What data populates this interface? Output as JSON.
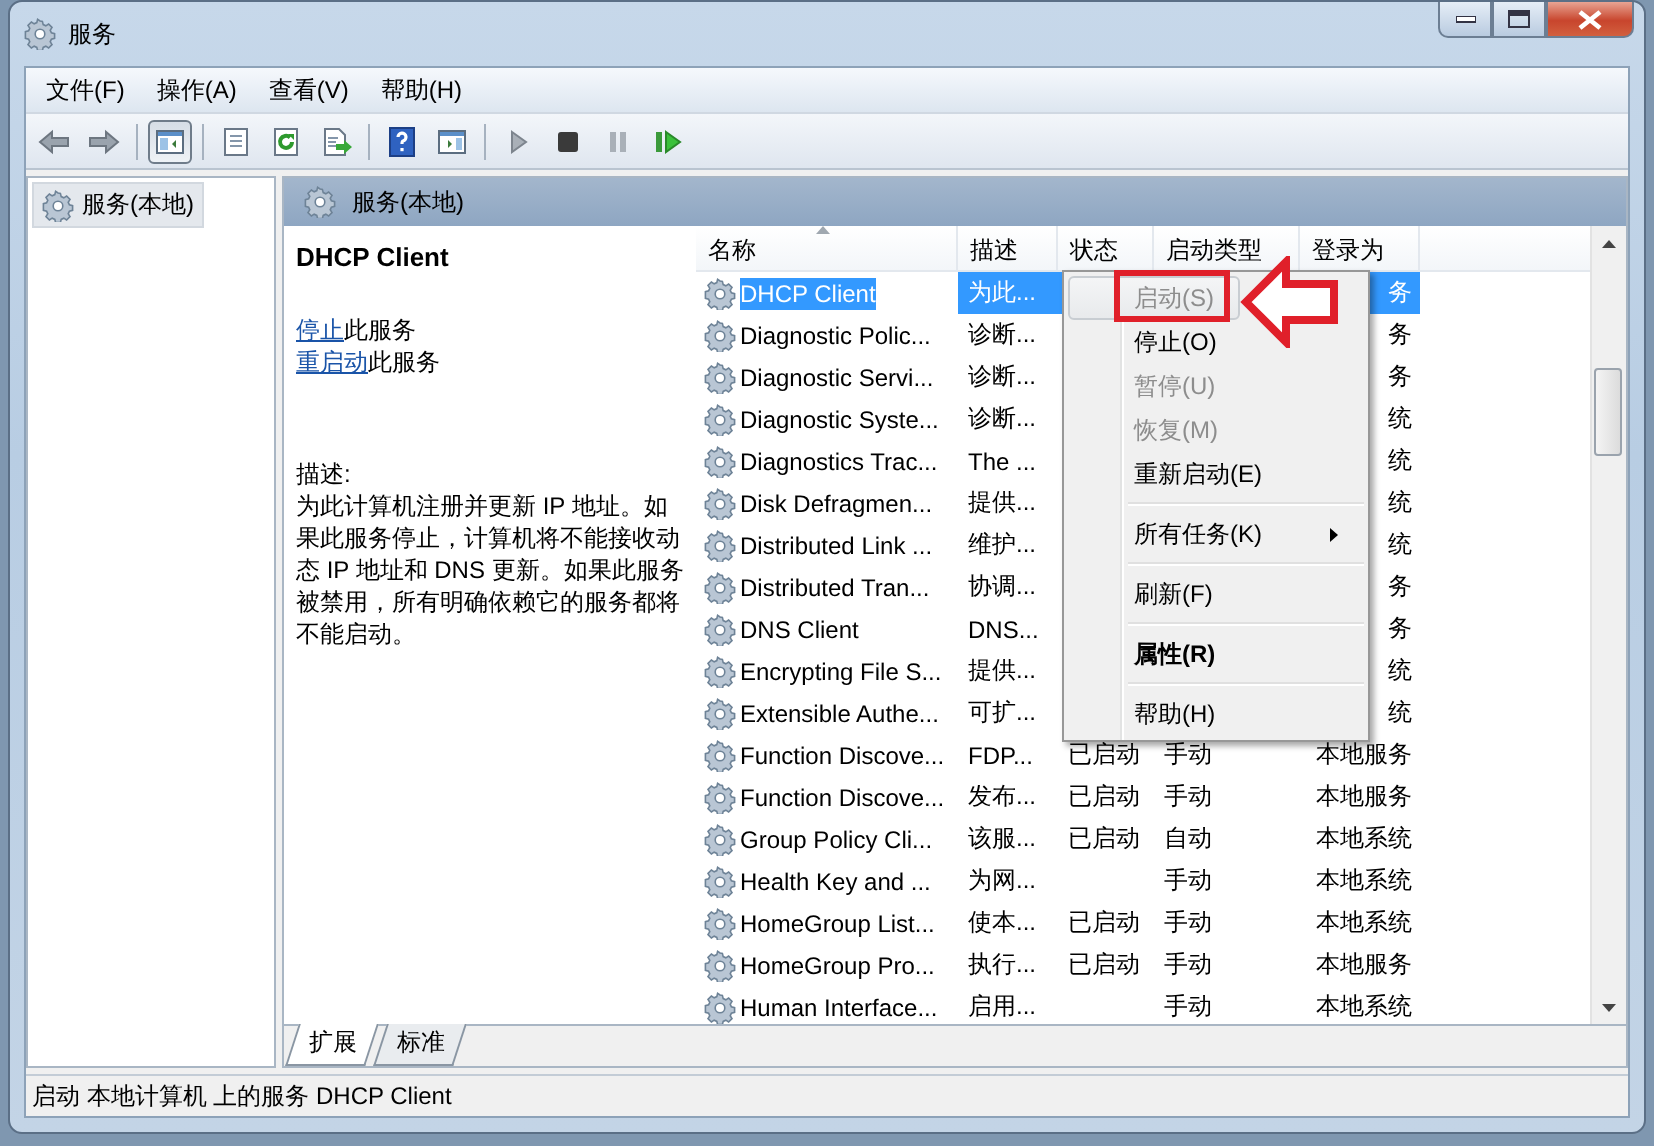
{
  "window": {
    "title": "服务"
  },
  "menubar": [
    "文件(F)",
    "操作(A)",
    "查看(V)",
    "帮助(H)"
  ],
  "toolbar": [
    {
      "kind": "back"
    },
    {
      "kind": "forward"
    },
    {
      "kind": "separator"
    },
    {
      "kind": "tree",
      "pressed": true
    },
    {
      "kind": "separator"
    },
    {
      "kind": "properties"
    },
    {
      "kind": "refresh"
    },
    {
      "kind": "export"
    },
    {
      "kind": "separator"
    },
    {
      "kind": "help"
    },
    {
      "kind": "pane",
      "pressed": false
    },
    {
      "kind": "separator"
    },
    {
      "kind": "play"
    },
    {
      "kind": "stop"
    },
    {
      "kind": "pause"
    },
    {
      "kind": "resume"
    }
  ],
  "tree": {
    "items": [
      {
        "label": "服务(本地)",
        "selected": true
      }
    ]
  },
  "pane_header": "服务(本地)",
  "details": {
    "title": "DHCP Client",
    "actions": [
      {
        "link": "停止",
        "text": "此服务"
      },
      {
        "link": "重启动",
        "text": "此服务"
      }
    ],
    "description_label": "描述:",
    "description": "为此计算机注册并更新 IP 地址。如果此服务停止，计算机将不能接收动态 IP 地址和 DNS 更新。如果此服务被禁用，所有明确依赖它的服务都将不能启动。"
  },
  "table": {
    "columns": [
      "名称",
      "描述",
      "状态",
      "启动类型",
      "登录为"
    ],
    "rows": [
      {
        "name": "DHCP Client",
        "description": "为此...",
        "login_as": "务",
        "selected": true
      },
      {
        "name": "Diagnostic Polic...",
        "description": "诊断...",
        "login_as": "务",
        "selected": false
      },
      {
        "name": "Diagnostic Servi...",
        "description": "诊断...",
        "login_as": "务",
        "selected": false
      },
      {
        "name": "Diagnostic Syste...",
        "description": "诊断...",
        "login_as": "统",
        "selected": false
      },
      {
        "name": "Diagnostics Trac...",
        "description": "The ...",
        "login_as": "统",
        "selected": false
      },
      {
        "name": "Disk Defragmen...",
        "description": "提供...",
        "login_as": "统",
        "selected": false
      },
      {
        "name": "Distributed Link ...",
        "description": "维护...",
        "login_as": "统",
        "selected": false
      },
      {
        "name": "Distributed Tran...",
        "description": "协调...",
        "login_as": "务",
        "selected": false
      },
      {
        "name": "DNS Client",
        "description": "DNS...",
        "login_as": "务",
        "selected": false
      },
      {
        "name": "Encrypting File S...",
        "description": "提供...",
        "login_as": "统",
        "selected": false
      },
      {
        "name": "Extensible Authe...",
        "description": "可扩...",
        "login_as": "统",
        "selected": false
      },
      {
        "name": "Function Discove...",
        "description": "FDP...",
        "status": "已启动",
        "startup_type": "手动",
        "login_as": "本地服务",
        "selected": false
      },
      {
        "name": "Function Discove...",
        "description": "发布...",
        "status": "已启动",
        "startup_type": "手动",
        "login_as": "本地服务",
        "selected": false
      },
      {
        "name": "Group Policy Cli...",
        "description": "该服...",
        "status": "已启动",
        "startup_type": "自动",
        "login_as": "本地系统",
        "selected": false
      },
      {
        "name": "Health Key and ...",
        "description": "为网...",
        "startup_type": "手动",
        "login_as": "本地系统",
        "selected": false
      },
      {
        "name": "HomeGroup List...",
        "description": "使本...",
        "status": "已启动",
        "startup_type": "手动",
        "login_as": "本地系统",
        "selected": false
      },
      {
        "name": "HomeGroup Pro...",
        "description": "执行...",
        "status": "已启动",
        "startup_type": "手动",
        "login_as": "本地服务",
        "selected": false
      },
      {
        "name": "Human Interface...",
        "description": "启用...",
        "startup_type": "手动",
        "login_as": "本地系统",
        "selected": false
      }
    ]
  },
  "context_menu": [
    {
      "kind": "item",
      "label": "启动(S)",
      "disabled": true,
      "selected": true,
      "annotated": true
    },
    {
      "kind": "item",
      "label": "停止(O)",
      "disabled": false,
      "selected": false
    },
    {
      "kind": "item",
      "label": "暂停(U)",
      "disabled": true,
      "selected": false
    },
    {
      "kind": "item",
      "label": "恢复(M)",
      "disabled": true,
      "selected": false
    },
    {
      "kind": "item",
      "label": "重新启动(E)",
      "disabled": false,
      "selected": false
    },
    {
      "kind": "separator"
    },
    {
      "kind": "item",
      "label": "所有任务(K)",
      "disabled": false,
      "selected": false,
      "submenu": true
    },
    {
      "kind": "separator"
    },
    {
      "kind": "item",
      "label": "刷新(F)",
      "disabled": false,
      "selected": false
    },
    {
      "kind": "separator"
    },
    {
      "kind": "item",
      "label": "属性(R)",
      "disabled": false,
      "selected": false,
      "bold": true
    },
    {
      "kind": "separator"
    },
    {
      "kind": "item",
      "label": "帮助(H)",
      "disabled": false,
      "selected": false
    }
  ],
  "bottom_tabs": [
    {
      "label": "扩展",
      "selected": true
    },
    {
      "label": "标准",
      "selected": false
    }
  ],
  "status_bar": "启动 本地计算机 上的服务 DHCP Client"
}
